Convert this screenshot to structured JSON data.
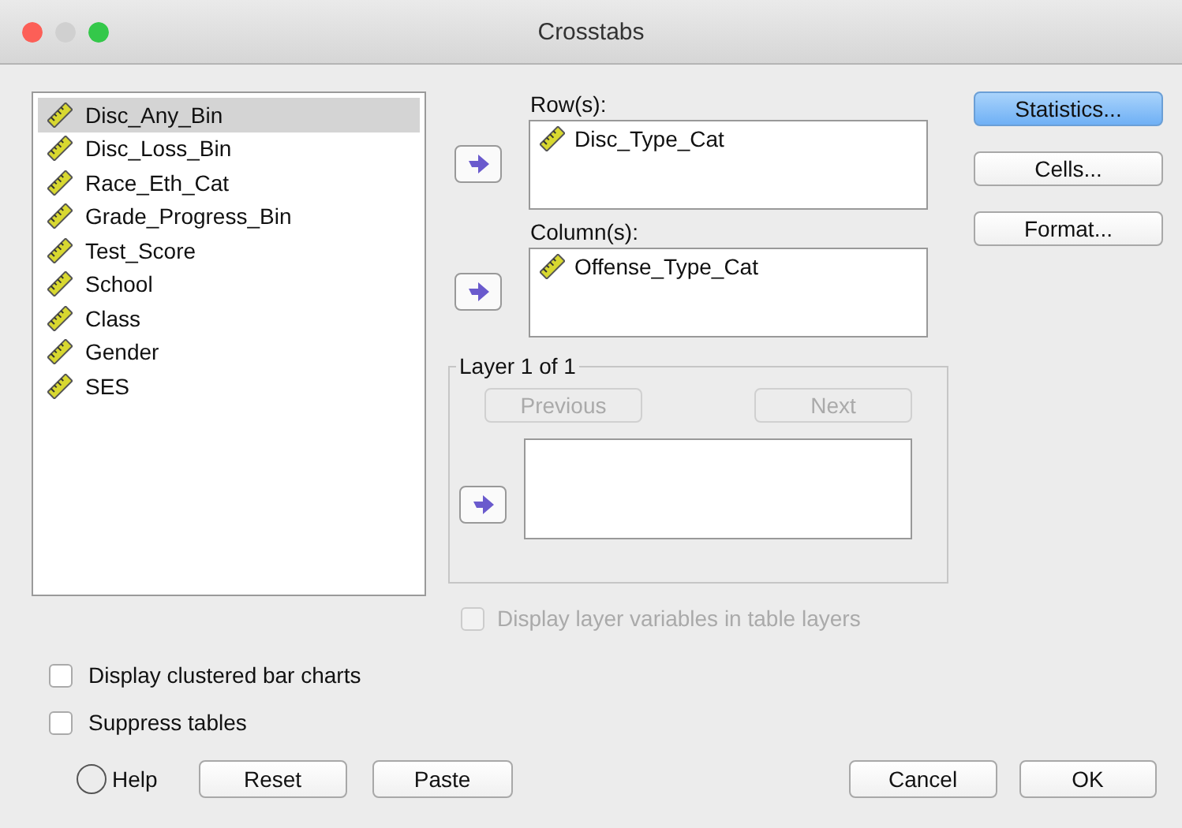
{
  "window": {
    "title": "Crosstabs"
  },
  "variables": [
    {
      "name": "Disc_Any_Bin",
      "selected": true
    },
    {
      "name": "Disc_Loss_Bin",
      "selected": false
    },
    {
      "name": "Race_Eth_Cat",
      "selected": false
    },
    {
      "name": "Grade_Progress_Bin",
      "selected": false
    },
    {
      "name": "Test_Score",
      "selected": false
    },
    {
      "name": "School",
      "selected": false
    },
    {
      "name": "Class",
      "selected": false
    },
    {
      "name": "Gender",
      "selected": false
    },
    {
      "name": "SES",
      "selected": false
    }
  ],
  "rows": {
    "label": "Row(s):",
    "items": [
      "Disc_Type_Cat"
    ]
  },
  "columns": {
    "label": "Column(s):",
    "items": [
      "Offense_Type_Cat"
    ]
  },
  "layer": {
    "title": "Layer 1 of 1",
    "buttons": [
      {
        "label": "Previous",
        "disabled": true
      },
      {
        "label": "Next",
        "disabled": true
      }
    ]
  },
  "layer_option": {
    "label": "Display layer variables in table layers",
    "checked": false,
    "disabled": true
  },
  "side_buttons": [
    {
      "label": "Statistics...",
      "focused": true
    },
    {
      "label": "Cells...",
      "focused": false
    },
    {
      "label": "Format...",
      "focused": false
    }
  ],
  "options": [
    {
      "label": "Display clustered bar charts",
      "checked": false
    },
    {
      "label": "Suppress tables",
      "checked": false
    }
  ],
  "footer_buttons": [
    {
      "label": "Help",
      "kind": "help"
    },
    {
      "label": "Reset",
      "kind": "push"
    },
    {
      "label": "Paste",
      "kind": "push"
    },
    {
      "label": "Cancel",
      "kind": "push"
    },
    {
      "label": "OK",
      "kind": "push"
    }
  ]
}
